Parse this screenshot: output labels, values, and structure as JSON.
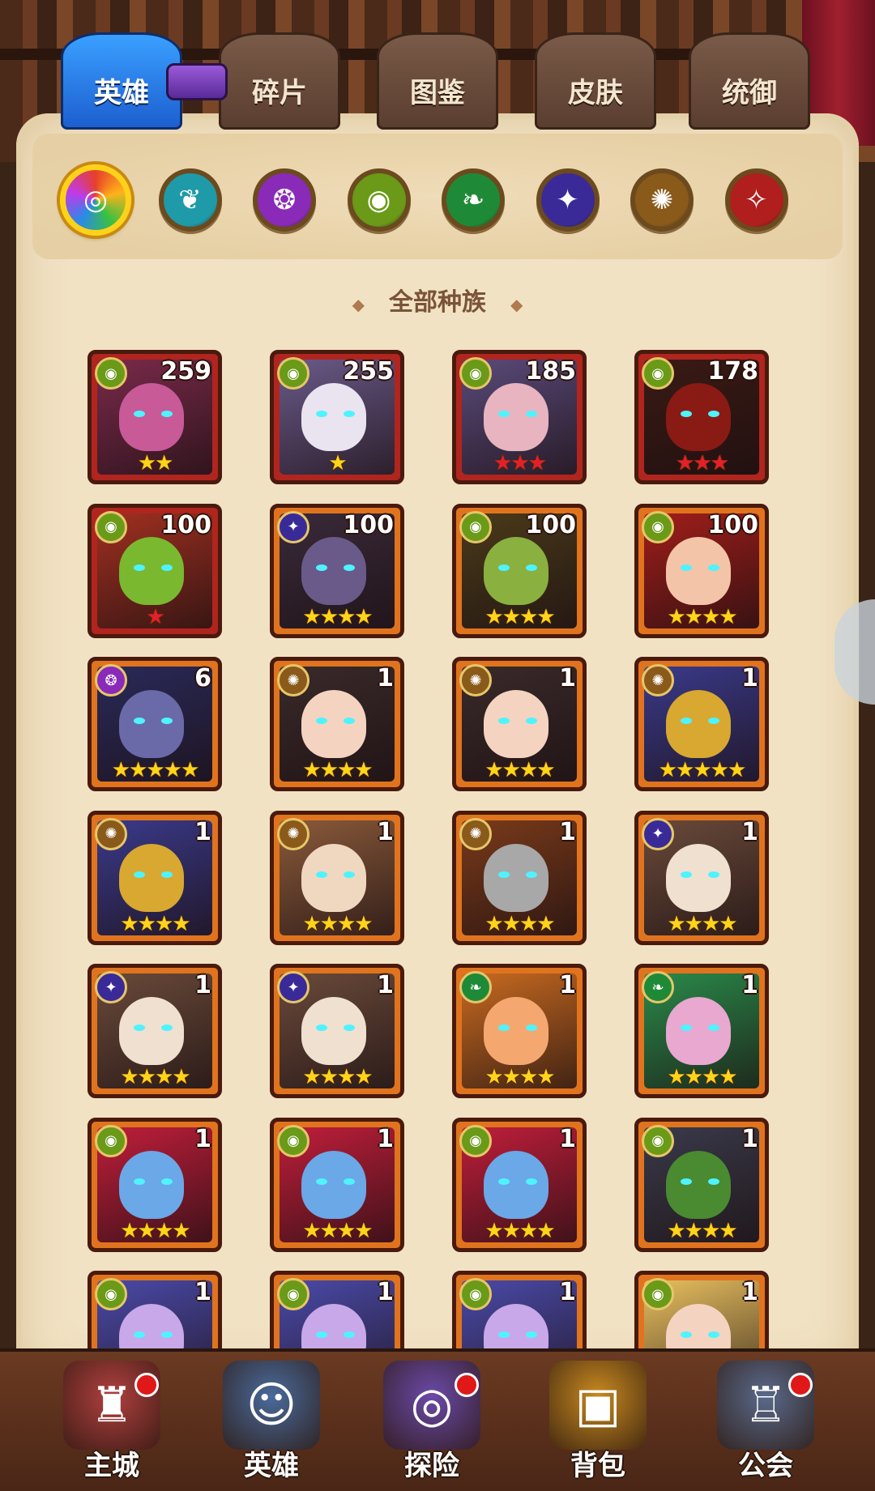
{
  "tabs": [
    {
      "label": "英雄",
      "active": true
    },
    {
      "label": "碎片",
      "active": false
    },
    {
      "label": "图鉴",
      "active": false
    },
    {
      "label": "皮肤",
      "active": false
    },
    {
      "label": "统御",
      "active": false
    }
  ],
  "filters": [
    {
      "name": "all-races-icon",
      "glyph": "◎",
      "color": "#e8502a",
      "selected": true
    },
    {
      "name": "race-1-icon",
      "glyph": "❦",
      "color": "#1f9aa8",
      "selected": false
    },
    {
      "name": "race-2-icon",
      "glyph": "❂",
      "color": "#8a2ab8",
      "selected": false
    },
    {
      "name": "race-3-icon",
      "glyph": "◉",
      "color": "#6a9a18",
      "selected": false
    },
    {
      "name": "race-4-icon",
      "glyph": "❧",
      "color": "#1e8a38",
      "selected": false
    },
    {
      "name": "race-5-icon",
      "glyph": "✦",
      "color": "#3a2a98",
      "selected": false
    },
    {
      "name": "race-6-icon",
      "glyph": "✺",
      "color": "#8a5a1a",
      "selected": false
    },
    {
      "name": "race-7-icon",
      "glyph": "✧",
      "color": "#b01e1e",
      "selected": false
    }
  ],
  "race_label": "全部种族",
  "heroes": [
    {
      "level": "259",
      "stars": "★★",
      "star_color": "gold",
      "frame": "red",
      "race_color": "#6a9a18",
      "race_glyph": "◉",
      "bg": "#7a2a4a",
      "skin": "#c85a98"
    },
    {
      "level": "255",
      "stars": "★",
      "star_color": "gold",
      "frame": "red",
      "race_color": "#6a9a18",
      "race_glyph": "◉",
      "bg": "#6a5a8a",
      "skin": "#e9e4f0"
    },
    {
      "level": "185",
      "stars": "★★★",
      "star_color": "red",
      "frame": "red",
      "race_color": "#6a9a18",
      "race_glyph": "◉",
      "bg": "#5a4a7a",
      "skin": "#e8b4c0"
    },
    {
      "level": "178",
      "stars": "★★★",
      "star_color": "red",
      "frame": "red",
      "race_color": "#6a9a18",
      "race_glyph": "◉",
      "bg": "#3a1a14",
      "skin": "#8a1a14"
    },
    {
      "level": "100",
      "stars": "★",
      "star_color": "red",
      "frame": "red",
      "race_color": "#6a9a18",
      "race_glyph": "◉",
      "bg": "#a03020",
      "skin": "#7ab830"
    },
    {
      "level": "100",
      "stars": "★★★★",
      "star_color": "gold",
      "frame": "orange",
      "race_color": "#3a2a98",
      "race_glyph": "✦",
      "bg": "#3a2a3a",
      "skin": "#6a5a8a"
    },
    {
      "level": "100",
      "stars": "★★★★",
      "star_color": "gold",
      "frame": "orange",
      "race_color": "#6a9a18",
      "race_glyph": "◉",
      "bg": "#4a3a1a",
      "skin": "#8ab040"
    },
    {
      "level": "100",
      "stars": "★★★★",
      "star_color": "gold",
      "frame": "orange",
      "race_color": "#6a9a18",
      "race_glyph": "◉",
      "bg": "#a01e1a",
      "skin": "#f4c4a8"
    },
    {
      "level": "6",
      "stars": "★★★★★",
      "star_color": "gold",
      "frame": "orange",
      "race_color": "#8a2ab8",
      "race_glyph": "❂",
      "bg": "#2a2a5a",
      "skin": "#6a6aa8"
    },
    {
      "level": "1",
      "stars": "★★★★",
      "star_color": "gold",
      "frame": "orange",
      "race_color": "#8a5a1a",
      "race_glyph": "✺",
      "bg": "#3a2a2a",
      "skin": "#f4d4c0"
    },
    {
      "level": "1",
      "stars": "★★★★",
      "star_color": "gold",
      "frame": "orange",
      "race_color": "#8a5a1a",
      "race_glyph": "✺",
      "bg": "#3a2a2a",
      "skin": "#f4d4c0"
    },
    {
      "level": "1",
      "stars": "★★★★★",
      "star_color": "gold",
      "frame": "orange",
      "race_color": "#8a5a1a",
      "race_glyph": "✺",
      "bg": "#3a3a8a",
      "skin": "#d8a830"
    },
    {
      "level": "1",
      "stars": "★★★★",
      "star_color": "gold",
      "frame": "orange",
      "race_color": "#8a5a1a",
      "race_glyph": "✺",
      "bg": "#3a3a8a",
      "skin": "#d8a830"
    },
    {
      "level": "1",
      "stars": "★★★★",
      "star_color": "gold",
      "frame": "orange",
      "race_color": "#8a5a1a",
      "race_glyph": "✺",
      "bg": "#8a5a3a",
      "skin": "#f0d8c0"
    },
    {
      "level": "1",
      "stars": "★★★★",
      "star_color": "gold",
      "frame": "orange",
      "race_color": "#8a5a1a",
      "race_glyph": "✺",
      "bg": "#7a3a1a",
      "skin": "#a8a8a8"
    },
    {
      "level": "1",
      "stars": "★★★★",
      "star_color": "gold",
      "frame": "orange",
      "race_color": "#3a2a98",
      "race_glyph": "✦",
      "bg": "#6a4a3a",
      "skin": "#f0e0d0"
    },
    {
      "level": "1",
      "stars": "★★★★",
      "star_color": "gold",
      "frame": "orange",
      "race_color": "#3a2a98",
      "race_glyph": "✦",
      "bg": "#6a4a3a",
      "skin": "#f0e0d0"
    },
    {
      "level": "1",
      "stars": "★★★★",
      "star_color": "gold",
      "frame": "orange",
      "race_color": "#3a2a98",
      "race_glyph": "✦",
      "bg": "#6a4a3a",
      "skin": "#f0e0d0"
    },
    {
      "level": "1",
      "stars": "★★★★",
      "star_color": "gold",
      "frame": "orange",
      "race_color": "#1e8a38",
      "race_glyph": "❧",
      "bg": "#c86a20",
      "skin": "#f4a870"
    },
    {
      "level": "1",
      "stars": "★★★★",
      "star_color": "gold",
      "frame": "orange",
      "race_color": "#1e8a38",
      "race_glyph": "❧",
      "bg": "#2a8a4a",
      "skin": "#e8a8d0"
    },
    {
      "level": "1",
      "stars": "★★★★",
      "star_color": "gold",
      "frame": "orange",
      "race_color": "#6a9a18",
      "race_glyph": "◉",
      "bg": "#c01e3a",
      "skin": "#6aa8e8"
    },
    {
      "level": "1",
      "stars": "★★★★",
      "star_color": "gold",
      "frame": "orange",
      "race_color": "#6a9a18",
      "race_glyph": "◉",
      "bg": "#c01e3a",
      "skin": "#6aa8e8"
    },
    {
      "level": "1",
      "stars": "★★★★",
      "star_color": "gold",
      "frame": "orange",
      "race_color": "#6a9a18",
      "race_glyph": "◉",
      "bg": "#c01e3a",
      "skin": "#6aa8e8"
    },
    {
      "level": "1",
      "stars": "★★★★",
      "star_color": "gold",
      "frame": "orange",
      "race_color": "#6a9a18",
      "race_glyph": "◉",
      "bg": "#3a3a4a",
      "skin": "#4a8a30"
    },
    {
      "level": "1",
      "stars": "",
      "star_color": "gold",
      "frame": "orange",
      "race_color": "#6a9a18",
      "race_glyph": "◉",
      "bg": "#4a4aa8",
      "skin": "#c8a8e8"
    },
    {
      "level": "1",
      "stars": "",
      "star_color": "gold",
      "frame": "orange",
      "race_color": "#6a9a18",
      "race_glyph": "◉",
      "bg": "#4a4aa8",
      "skin": "#c8a8e8"
    },
    {
      "level": "1",
      "stars": "",
      "star_color": "gold",
      "frame": "orange",
      "race_color": "#6a9a18",
      "race_glyph": "◉",
      "bg": "#4a4aa8",
      "skin": "#c8a8e8"
    },
    {
      "level": "1",
      "stars": "",
      "star_color": "gold",
      "frame": "orange",
      "race_color": "#6a9a18",
      "race_glyph": "◉",
      "bg": "#e8c060",
      "skin": "#f4d4c0"
    }
  ],
  "nav": [
    {
      "label": "主城",
      "icon": "castle-icon",
      "glyph": "♜",
      "color": "#b04040",
      "dot": true
    },
    {
      "label": "英雄",
      "icon": "hero-icon",
      "glyph": "☺",
      "color": "#4a6a9a",
      "dot": false
    },
    {
      "label": "探险",
      "icon": "portal-icon",
      "glyph": "◎",
      "color": "#6a4aa8",
      "dot": true
    },
    {
      "label": "背包",
      "icon": "backpack-icon",
      "glyph": "▣",
      "color": "#c88a20",
      "dot": false
    },
    {
      "label": "公会",
      "icon": "guild-icon",
      "glyph": "♖",
      "color": "#5a6a8a",
      "dot": true
    }
  ]
}
